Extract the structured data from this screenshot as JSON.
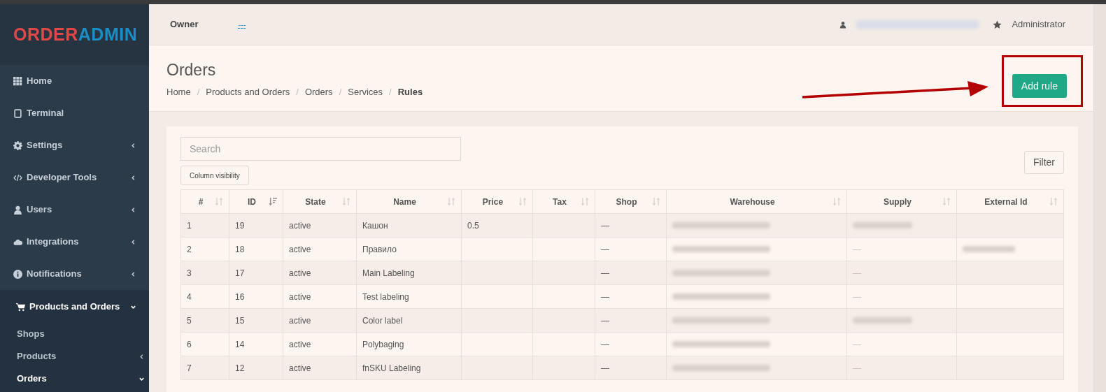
{
  "logo": {
    "part_1": "ORDER",
    "part_2": "ADMIN"
  },
  "sidebar": {
    "items": [
      {
        "label": "Home",
        "has_submenu": false
      },
      {
        "label": "Terminal",
        "has_submenu": false
      },
      {
        "label": "Settings",
        "has_submenu": true
      },
      {
        "label": "Developer Tools",
        "has_submenu": true
      },
      {
        "label": "Users",
        "has_submenu": true
      },
      {
        "label": "Integrations",
        "has_submenu": true
      },
      {
        "label": "Notifications",
        "has_submenu": true
      },
      {
        "label": "Products and Orders",
        "has_submenu": true,
        "expanded": true,
        "children": [
          {
            "label": "Shops",
            "has_submenu": false,
            "selected": false
          },
          {
            "label": "Products",
            "has_submenu": true,
            "expanded": false,
            "selected": false
          },
          {
            "label": "Orders",
            "has_submenu": true,
            "expanded": true,
            "selected": true
          }
        ]
      }
    ]
  },
  "header": {
    "owner_label": "Owner",
    "owner_value": "---",
    "role": "Administrator"
  },
  "page": {
    "title": "Orders",
    "breadcrumbs": [
      {
        "label": "Home",
        "current": false
      },
      {
        "separator": "/",
        "label": "Products and Orders",
        "current": false
      },
      {
        "separator": "/",
        "label": "Orders",
        "current": false
      },
      {
        "separator": "/",
        "label": "Services",
        "current": false
      },
      {
        "separator": "/",
        "label": "Rules",
        "current": true
      }
    ],
    "add_button": "Add rule"
  },
  "toolbar": {
    "search_placeholder": "Search",
    "column_visibility": "Column visibility",
    "filter": "Filter"
  },
  "table": {
    "columns": [
      {
        "label": "#",
        "sorted": false
      },
      {
        "label": "ID",
        "sorted": true
      },
      {
        "label": "State",
        "sorted": false
      },
      {
        "label": "Name",
        "sorted": false
      },
      {
        "label": "Price",
        "sorted": false
      },
      {
        "label": "Tax",
        "sorted": false
      },
      {
        "label": "Shop",
        "sorted": false
      },
      {
        "label": "Warehouse",
        "sorted": false
      },
      {
        "label": "Supply",
        "sorted": false
      },
      {
        "label": "External Id",
        "sorted": false
      }
    ],
    "rows": [
      {
        "cells": [
          "1",
          "19",
          "active",
          "Кашон",
          "0.5",
          "",
          "—"
        ],
        "warehouse_blurred": true,
        "supply": "",
        "supply_blurred": true,
        "external_blurred": false
      },
      {
        "cells": [
          "2",
          "18",
          "active",
          "Правило",
          "",
          "",
          "—"
        ],
        "warehouse_blurred": true,
        "supply": "—",
        "supply_blurred": false,
        "external_blurred": true
      },
      {
        "cells": [
          "3",
          "17",
          "active",
          "Main Labeling",
          "",
          "",
          "—"
        ],
        "warehouse_blurred": true,
        "supply": "—",
        "supply_blurred": false,
        "external_blurred": false
      },
      {
        "cells": [
          "4",
          "16",
          "active",
          "Test labeling",
          "",
          "",
          "—"
        ],
        "warehouse_blurred": true,
        "supply": "—",
        "supply_blurred": false,
        "external_blurred": false
      },
      {
        "cells": [
          "5",
          "15",
          "active",
          "Color label",
          "",
          "",
          "—"
        ],
        "warehouse_blurred": true,
        "supply": "",
        "supply_blurred": true,
        "external_blurred": false
      },
      {
        "cells": [
          "6",
          "14",
          "active",
          "Polybaging",
          "",
          "",
          "—"
        ],
        "warehouse_blurred": true,
        "supply": "—",
        "supply_blurred": false,
        "external_blurred": false
      },
      {
        "cells": [
          "7",
          "12",
          "active",
          "fnSKU Labeling",
          "",
          "",
          "—"
        ],
        "warehouse_blurred": true,
        "supply": "—",
        "supply_blurred": false,
        "external_blurred": false
      }
    ]
  }
}
